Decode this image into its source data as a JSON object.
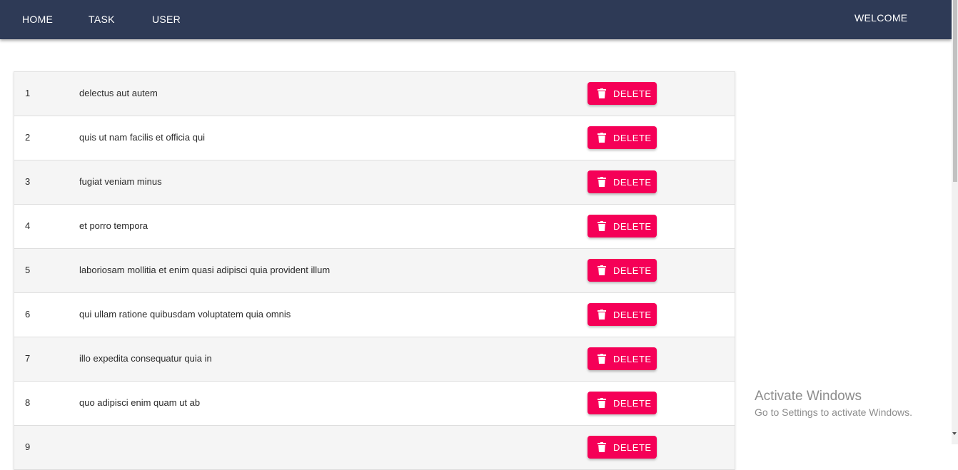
{
  "nav": {
    "home": "HOME",
    "task": "TASK",
    "user": "USER",
    "welcome": "WELCOME"
  },
  "tasks": [
    {
      "id": "1",
      "title": "delectus aut autem",
      "action": "DELETE"
    },
    {
      "id": "2",
      "title": "quis ut nam facilis et officia qui",
      "action": "DELETE"
    },
    {
      "id": "3",
      "title": "fugiat veniam minus",
      "action": "DELETE"
    },
    {
      "id": "4",
      "title": "et porro tempora",
      "action": "DELETE"
    },
    {
      "id": "5",
      "title": "laboriosam mollitia et enim quasi adipisci quia provident illum",
      "action": "DELETE"
    },
    {
      "id": "6",
      "title": "qui ullam ratione quibusdam voluptatem quia omnis",
      "action": "DELETE"
    },
    {
      "id": "7",
      "title": "illo expedita consequatur quia in",
      "action": "DELETE"
    },
    {
      "id": "8",
      "title": "quo adipisci enim quam ut ab",
      "action": "DELETE"
    },
    {
      "id": "9",
      "title": "",
      "action": "DELETE"
    }
  ],
  "watermark": {
    "title": "Activate Windows",
    "subtitle": "Go to Settings to activate Windows."
  },
  "colors": {
    "navbar": "#2e3a56",
    "delete_button": "#f50057",
    "row_odd": "#f5f5f5",
    "row_even": "#ffffff"
  },
  "icons": {
    "delete": "trash-icon"
  }
}
